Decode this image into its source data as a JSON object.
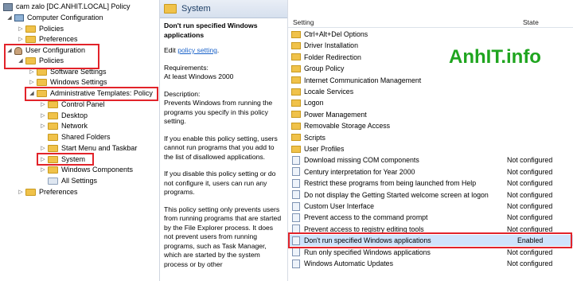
{
  "tree": {
    "root": "cam zalo [DC.ANHIT.LOCAL] Policy",
    "computer_config": "Computer Configuration",
    "cc_policies": "Policies",
    "cc_preferences": "Preferences",
    "user_config": "User Configuration",
    "uc_policies": "Policies",
    "software_settings": "Software Settings",
    "windows_settings": "Windows Settings",
    "admin_templates": "Administrative Templates: Policy",
    "control_panel": "Control Panel",
    "desktop": "Desktop",
    "network": "Network",
    "shared_folders": "Shared Folders",
    "start_menu": "Start Menu and Taskbar",
    "system": "System",
    "windows_components": "Windows Components",
    "all_settings": "All Settings",
    "uc_preferences": "Preferences"
  },
  "desc": {
    "header": "System",
    "title": "Don't run specified Windows applications",
    "edit_prefix": "Edit ",
    "edit_link": "policy setting",
    "edit_suffix": ".",
    "req_label": "Requirements:",
    "req_value": "At least Windows 2000",
    "desc_label": "Description:",
    "p1": "Prevents Windows from running the programs you specify in this policy setting.",
    "p2": "If you enable this policy setting, users cannot run programs that you add to the list of disallowed applications.",
    "p3": "If you disable this policy setting or do not configure it, users can run any programs.",
    "p4": "This policy setting only prevents users from running programs that are started by the File Explorer process. It does not prevent users from running programs, such as Task Manager, which are started by the system process or by other"
  },
  "list": {
    "col_setting": "Setting",
    "col_state": "State",
    "rows": [
      {
        "name": "Ctrl+Alt+Del Options",
        "state": "",
        "type": "folder"
      },
      {
        "name": "Driver Installation",
        "state": "",
        "type": "folder"
      },
      {
        "name": "Folder Redirection",
        "state": "",
        "type": "folder"
      },
      {
        "name": "Group Policy",
        "state": "",
        "type": "folder"
      },
      {
        "name": "Internet Communication Management",
        "state": "",
        "type": "folder"
      },
      {
        "name": "Locale Services",
        "state": "",
        "type": "folder"
      },
      {
        "name": "Logon",
        "state": "",
        "type": "folder"
      },
      {
        "name": "Power Management",
        "state": "",
        "type": "folder"
      },
      {
        "name": "Removable Storage Access",
        "state": "",
        "type": "folder"
      },
      {
        "name": "Scripts",
        "state": "",
        "type": "folder"
      },
      {
        "name": "User Profiles",
        "state": "",
        "type": "folder"
      },
      {
        "name": "Download missing COM components",
        "state": "Not configured",
        "type": "setting"
      },
      {
        "name": "Century interpretation for Year 2000",
        "state": "Not configured",
        "type": "setting"
      },
      {
        "name": "Restrict these programs from being launched from Help",
        "state": "Not configured",
        "type": "setting"
      },
      {
        "name": "Do not display the Getting Started welcome screen at logon",
        "state": "Not configured",
        "type": "setting"
      },
      {
        "name": "Custom User Interface",
        "state": "Not configured",
        "type": "setting"
      },
      {
        "name": "Prevent access to the command prompt",
        "state": "Not configured",
        "type": "setting"
      },
      {
        "name": "Prevent access to registry editing tools",
        "state": "Not configured",
        "type": "setting"
      },
      {
        "name": "Don't run specified Windows applications",
        "state": "Enabled",
        "type": "setting"
      },
      {
        "name": "Run only specified Windows applications",
        "state": "Not configured",
        "type": "setting"
      },
      {
        "name": "Windows Automatic Updates",
        "state": "Not configured",
        "type": "setting"
      }
    ]
  },
  "watermark": "AnhIT.info",
  "colors": {
    "highlight_box": "#e2232a",
    "watermark": "#1fa51f",
    "selected_row": "#cfe3fb"
  }
}
